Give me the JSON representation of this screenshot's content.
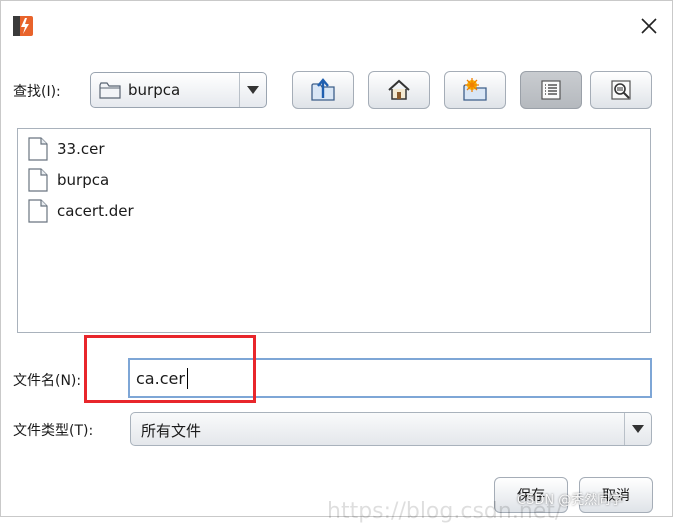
{
  "dialog": {
    "look_in_label": "查找(I):",
    "look_in_value": "burpca",
    "file_name_label": "文件名(N):",
    "file_name_value": "ca.cer",
    "file_type_label": "文件类型(T):",
    "file_type_value": "所有文件",
    "save_label": "保存",
    "cancel_label": "取消"
  },
  "toolbar": {
    "icons": [
      "up-folder-icon",
      "home-icon",
      "new-folder-icon",
      "list-view-icon",
      "details-view-icon"
    ],
    "active": "list-view-icon"
  },
  "files": [
    {
      "name": "33.cer"
    },
    {
      "name": "burpca"
    },
    {
      "name": "cacert.der"
    }
  ],
  "watermark": {
    "text": "CSDN @秃然同学",
    "url_fragment": "https://blog.csdn.net/"
  },
  "colors": {
    "highlight": "#e8262b",
    "focus_border": "#7ea6d6",
    "app_icon": "#e8632b"
  }
}
